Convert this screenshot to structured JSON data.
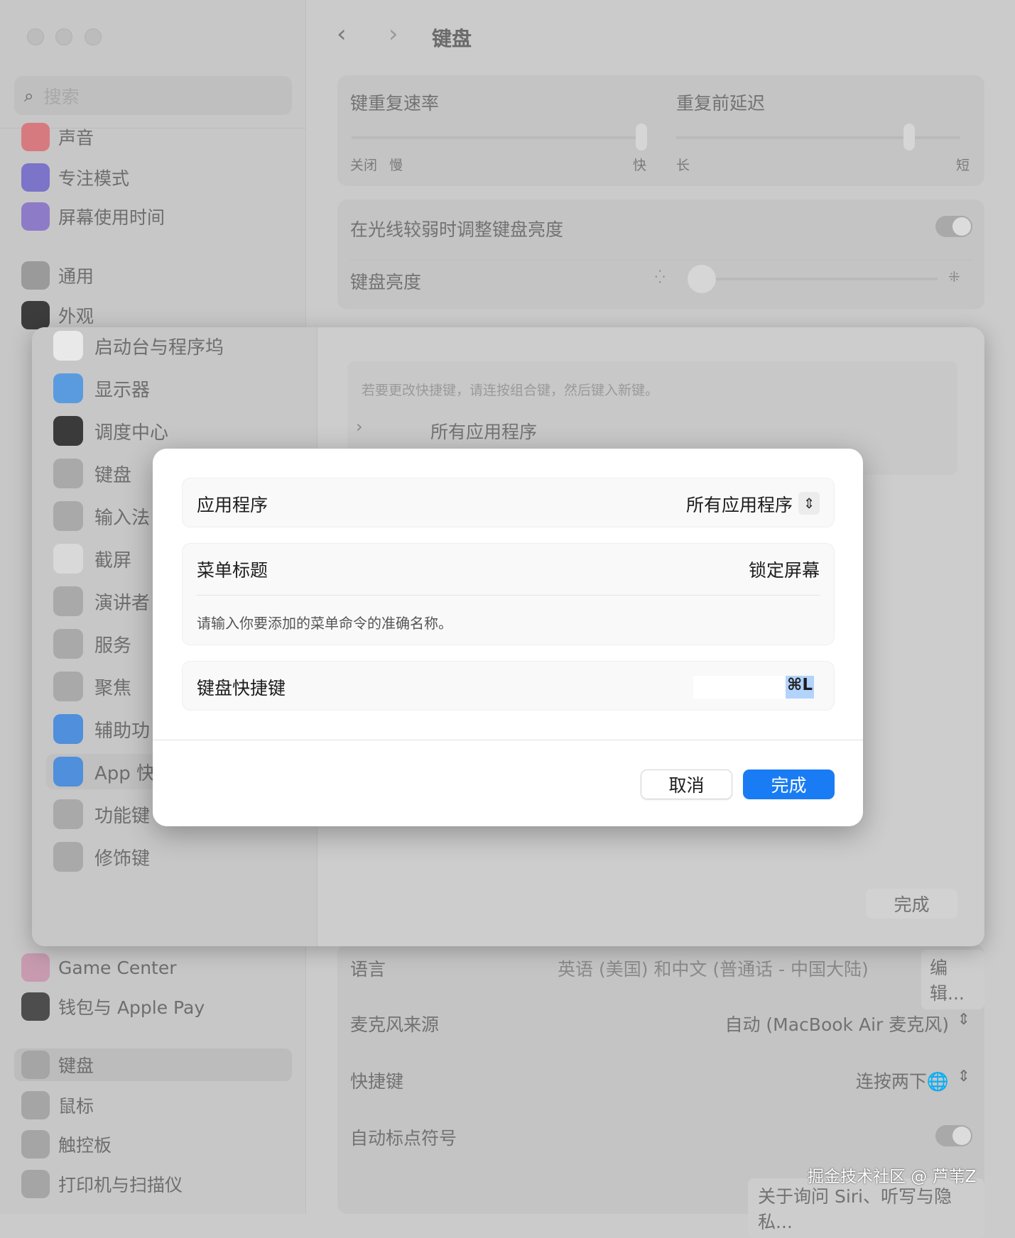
{
  "window": {
    "title": "键盘"
  },
  "sidebar": {
    "search_placeholder": "搜索",
    "items": [
      {
        "label": "声音",
        "color": "#d77a80"
      },
      {
        "label": "专注模式",
        "color": "#7b74c9"
      },
      {
        "label": "屏幕使用时间",
        "color": "#8e7bc7"
      },
      {
        "label": "通用",
        "color": "#9a9a9a"
      },
      {
        "label": "外观",
        "color": "#3c3c3c"
      },
      {
        "label": "Game Center",
        "color": "#c79ab0"
      },
      {
        "label": "钱包与 Apple Pay",
        "color": "#4d4d4d"
      },
      {
        "label": "键盘",
        "color": "#a5a5a5"
      },
      {
        "label": "鼠标",
        "color": "#a5a5a5"
      },
      {
        "label": "触控板",
        "color": "#a5a5a5"
      },
      {
        "label": "打印机与扫描仪",
        "color": "#a5a5a5"
      }
    ]
  },
  "main": {
    "key_repeat_rate": {
      "label": "键重复速率",
      "off": "关闭",
      "slow": "慢",
      "fast": "快",
      "value_fraction": 1.0
    },
    "delay_until_repeat": {
      "label": "重复前延迟",
      "long": "长",
      "short": "短",
      "value_fraction": 0.8
    },
    "adjust_brightness": {
      "label": "在光线较弱时调整键盘亮度",
      "on": false
    },
    "keyboard_brightness": {
      "label": "键盘亮度",
      "value_fraction": 0.0
    },
    "language": {
      "label": "语言",
      "value": "英语 (美国) 和中文 (普通话 - 中国大陆)",
      "edit": "编辑..."
    },
    "mic_source": {
      "label": "麦克风来源",
      "value": "自动 (MacBook Air 麦克风)"
    },
    "shortcut": {
      "label": "快捷键",
      "value": "连按两下🌐"
    },
    "auto_punct": {
      "label": "自动标点符号",
      "on": false
    },
    "privacy_button": "关于询问 Siri、听写与隐私..."
  },
  "sheet": {
    "items": [
      {
        "label": "启动台与程序坞",
        "color": "#e9e9e9"
      },
      {
        "label": "显示器",
        "color": "#5a9be0"
      },
      {
        "label": "调度中心",
        "color": "#3a3a3a"
      },
      {
        "label": "键盘",
        "color": "#a9a9a9"
      },
      {
        "label": "输入法",
        "color": "#a9a9a9"
      },
      {
        "label": "截屏",
        "color": "#d9d9d9"
      },
      {
        "label": "演讲者",
        "color": "#a9a9a9"
      },
      {
        "label": "服务",
        "color": "#a9a9a9"
      },
      {
        "label": "聚焦",
        "color": "#a9a9a9"
      },
      {
        "label": "辅助功",
        "color": "#4f8fdc"
      },
      {
        "label": "App 快",
        "color": "#4f8fdc"
      },
      {
        "label": "功能键",
        "color": "#a9a9a9"
      },
      {
        "label": "修饰键",
        "color": "#a9a9a9"
      }
    ],
    "hint": "若要更改快捷键，请连按组合键，然后键入新键。",
    "group": "所有应用程序",
    "done": "完成"
  },
  "dialog": {
    "app_label": "应用程序",
    "app_value": "所有应用程序",
    "menu_title_label": "菜单标题",
    "menu_title_value": "锁定屏幕",
    "menu_title_hint": "请输入你要添加的菜单命令的准确名称。",
    "shortcut_label": "键盘快捷键",
    "shortcut_value": "⌘L",
    "cancel": "取消",
    "done": "完成",
    "accent": "#1a7cf5"
  },
  "watermark": "掘金技术社区 @ 芦苇Z"
}
